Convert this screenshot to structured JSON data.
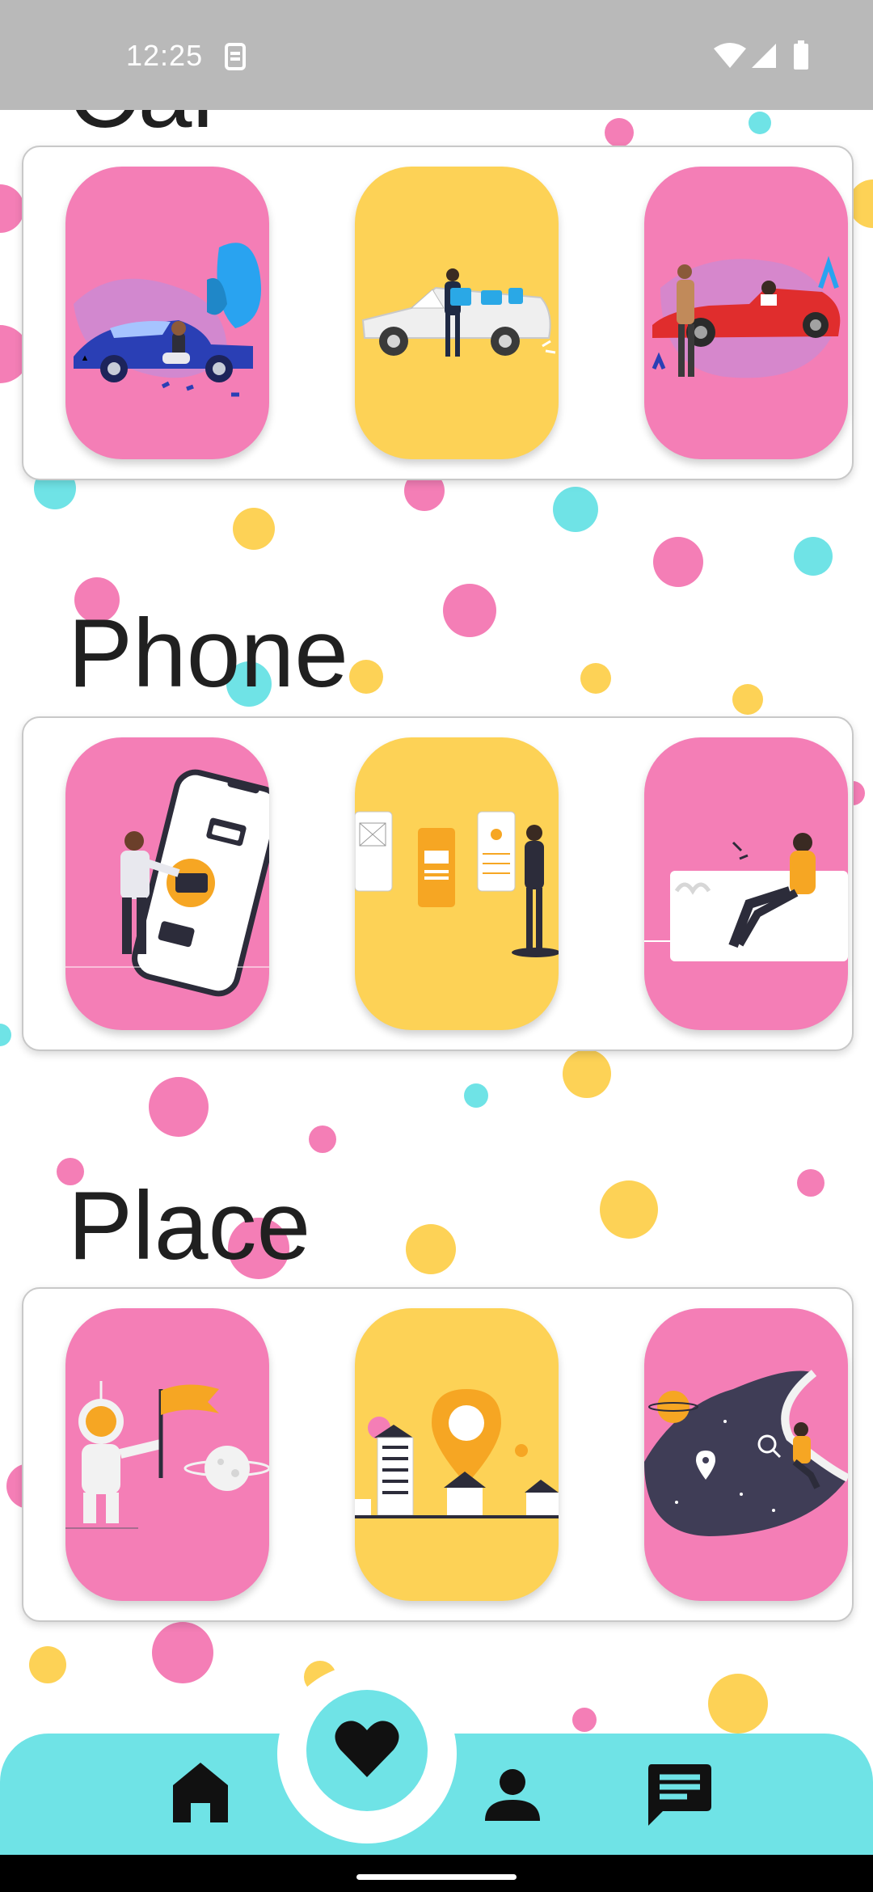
{
  "status_bar": {
    "time": "12:25",
    "icons": [
      "sim-card-icon",
      "wifi-icon",
      "signal-icon",
      "battery-icon"
    ]
  },
  "sections": [
    {
      "title": "Car",
      "tiles": [
        {
          "illustration": "car-repair-illustration",
          "color": "#f47eb6"
        },
        {
          "illustration": "car-luggage-illustration",
          "color": "#fdd256"
        },
        {
          "illustration": "red-convertible-illustration",
          "color": "#f47eb6"
        }
      ]
    },
    {
      "title": "Phone",
      "tiles": [
        {
          "illustration": "phone-wallet-illustration",
          "color": "#f47eb6"
        },
        {
          "illustration": "app-wireframe-illustration",
          "color": "#fdd256"
        },
        {
          "illustration": "person-on-screen-illustration",
          "color": "#f47eb6"
        }
      ]
    },
    {
      "title": "Place",
      "tiles": [
        {
          "illustration": "astronaut-flag-illustration",
          "color": "#f47eb6"
        },
        {
          "illustration": "city-location-pin-illustration",
          "color": "#fdd256"
        },
        {
          "illustration": "space-search-illustration",
          "color": "#f47eb6"
        }
      ]
    }
  ],
  "bottom_nav": {
    "items": [
      {
        "icon": "home-icon"
      },
      {
        "icon": "heart-icon",
        "selected": true
      },
      {
        "icon": "person-icon"
      },
      {
        "icon": "chat-icon"
      }
    ],
    "color": "#6fe3e6"
  },
  "colors": {
    "pink": "#f47eb6",
    "yellow": "#fdd256",
    "cyan": "#6fe3e6",
    "text": "#202020"
  }
}
